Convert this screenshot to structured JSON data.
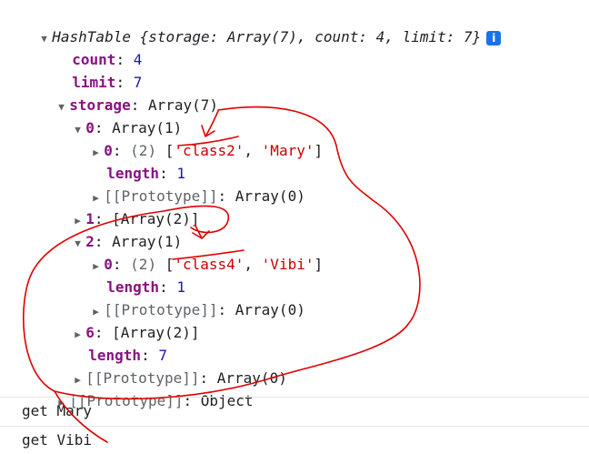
{
  "header": {
    "expanded_icon": "triangle-down-icon",
    "preview": "HashTable {storage: Array(7), count: 4, limit: 7}",
    "info_icon_label": "i"
  },
  "tree": {
    "count": {
      "key": "count",
      "value": "4"
    },
    "limit": {
      "key": "limit",
      "value": "7"
    },
    "storage": {
      "key": "storage",
      "value": "Array(7)"
    },
    "storage_0": {
      "key": "0",
      "value": "Array(1)"
    },
    "storage_0_0": {
      "key": "0",
      "prefix": "(2)",
      "v1": "'class2'",
      "v2": "'Mary'"
    },
    "storage_0_length": {
      "key": "length",
      "value": "1"
    },
    "storage_0_proto": {
      "key": "[[Prototype]]",
      "value": "Array(0)"
    },
    "storage_1": {
      "key": "1",
      "value": "[Array(2)]"
    },
    "storage_2": {
      "key": "2",
      "value": "Array(1)"
    },
    "storage_2_0": {
      "key": "0",
      "prefix": "(2)",
      "v1": "'class4'",
      "v2": "'Vibi'"
    },
    "storage_2_length": {
      "key": "length",
      "value": "1"
    },
    "storage_2_proto": {
      "key": "[[Prototype]]",
      "value": "Array(0)"
    },
    "storage_6": {
      "key": "6",
      "value": "[Array(2)]"
    },
    "storage_length": {
      "key": "length",
      "value": "7"
    },
    "storage_proto": {
      "key": "[[Prototype]]",
      "value": "Array(0)"
    },
    "object_proto": {
      "key": "[[Prototype]]",
      "value": "Object"
    }
  },
  "console": {
    "line1": "get Mary",
    "line2": "get Vibi"
  },
  "colors": {
    "key": "#881280",
    "number": "#1a1aa6",
    "string": "#c80000",
    "annotation": "#e00000",
    "info_badge": "#1a73e8"
  }
}
